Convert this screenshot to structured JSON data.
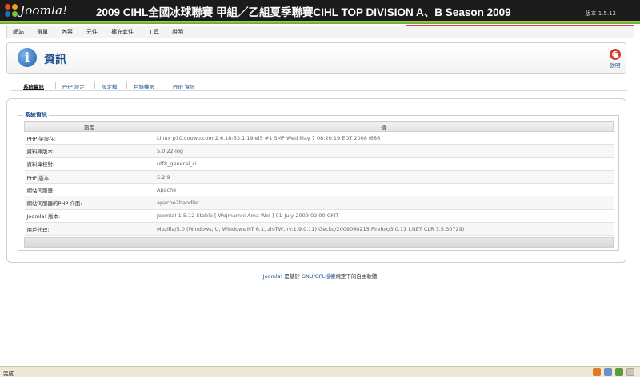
{
  "header": {
    "logo_text": "Joomla!",
    "site_title": "2009 CIHL全國冰球聯賽 甲組／乙組夏季聯賽CIHL TOP DIVISION A、B Season 2009",
    "version": "版本 1.5.12"
  },
  "menu": {
    "items": [
      "網站",
      "選單",
      "內容",
      "元件",
      "擴充套件",
      "工具",
      "說明"
    ]
  },
  "toolbar": {
    "title": "資訊",
    "help_label": "說明"
  },
  "tabs": [
    "系統資訊",
    "PHP 設定",
    "設定檔",
    "目錄權限",
    "PHP 資訊"
  ],
  "system_info": {
    "legend": "系統資訊",
    "columns": [
      "設定",
      "值"
    ],
    "rows": [
      {
        "key": "PHP 架設在:",
        "value": "Linux p10.coowo.com 2.6.18-53.1.19.el5 #1 SMP Wed May 7 08:20:19 EDT 2008 i686"
      },
      {
        "key": "資料庫版本:",
        "value": "5.0.22-log"
      },
      {
        "key": "資料庫校對:",
        "value": "utf8_general_ci"
      },
      {
        "key": "PHP 版本:",
        "value": "5.2.9"
      },
      {
        "key": "網站伺服器:",
        "value": "Apache"
      },
      {
        "key": "網站伺服器的PHP 介面:",
        "value": "apache2handler"
      },
      {
        "key": "Joomla! 版本:",
        "value": "Joomla! 1.5.12 Stable [ Wojmamni Ama Woi ] 01-July-2009 02:00 GMT"
      },
      {
        "key": "用戶代理:",
        "value": "Mozilla/5.0 (Windows; U; Windows NT 6.1; zh-TW; rv:1.9.0.11) Gecko/2009060215 Firefox/3.0.11 (.NET CLR 3.5.30729)"
      }
    ]
  },
  "footer": {
    "link1": "Joomla!",
    "text1": " 是基於 ",
    "link2": "GNU/GPL授權",
    "text2": "規定下的自由軟體"
  },
  "statusbar": {
    "text": "完成"
  },
  "colors": {
    "header_bg": "#1b1b1b",
    "accent_green": "#8cc63f",
    "link_blue": "#1a4f8b"
  }
}
